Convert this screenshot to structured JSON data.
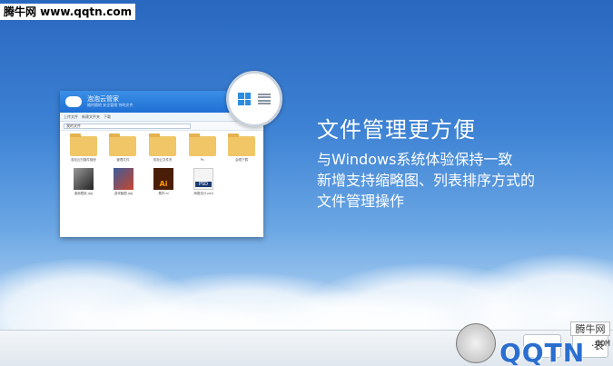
{
  "watermark": {
    "site": "腾牛网 www.qqtn.com",
    "badge_name": "腾牛网",
    "badge_logo": "QQTN",
    "badge_suffix": ".COM"
  },
  "mockup": {
    "brand": "泡泡云管家",
    "subtitle": "随时随地 安全管理 你的文件",
    "nav": [
      "上传文件",
      "新建文件夹",
      "下载"
    ],
    "address": "我的文件",
    "items": [
      {
        "type": "folder",
        "caption": "泡泡云扫描件相册"
      },
      {
        "type": "folder",
        "caption": "管理文件"
      },
      {
        "type": "folder",
        "caption": "泡泡云文件夹"
      },
      {
        "type": "folder",
        "caption": "Ps"
      },
      {
        "type": "folder",
        "caption": "会晤下载"
      },
      {
        "type": "photo",
        "caption": "桌面壁纸.jpg"
      },
      {
        "type": "game",
        "caption": "游戏截图.jpg"
      },
      {
        "type": "ai",
        "caption": "素材.ai",
        "label": "Ai"
      },
      {
        "type": "psd",
        "caption": "海报设计.psd",
        "label": "PSD"
      }
    ]
  },
  "view_switch": {
    "grid_icon": "windows-grid-icon",
    "list_icon": "list-view-icon"
  },
  "feature": {
    "headline": "文件管理更方便",
    "lines": [
      "与Windows系统体验保持一致",
      "新增支持缩略图、列表排序方式的",
      "文件管理操作"
    ]
  },
  "bottom": {
    "button_label": "表"
  },
  "colors": {
    "accent": "#2a8ce2",
    "folder": "#f1c667",
    "headline": "#ffffff"
  }
}
